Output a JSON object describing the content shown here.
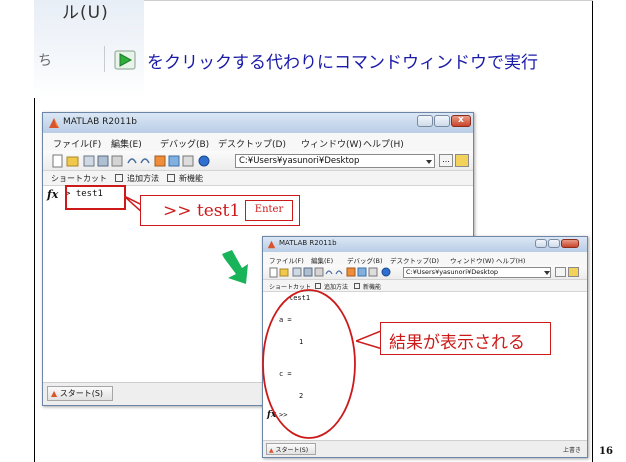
{
  "top_crop": {
    "menu_fragment": "ル(U)",
    "left_icon_fragment": "ち"
  },
  "headline": "をクリックする代わりにコマンドウィンドウで実行",
  "window_main": {
    "title": "MATLAB  R2011b",
    "menu": [
      "ファイル(F)",
      "編集(E)",
      "デバッグ(B)",
      "デスクトップ(D)",
      "ウィンドウ(W)",
      "ヘルプ(H)"
    ],
    "path": "C:¥Users¥yasunori¥Desktop",
    "shortcut_items": [
      "ショートカット",
      "追加方法",
      "新機能"
    ],
    "prompt": "> test1",
    "start_label": "スタート(S)"
  },
  "callout_command": {
    "text": ">> test1",
    "enter_label": "Enter"
  },
  "window_result": {
    "title": "MATLAB R2011b",
    "menu": [
      "ファイル(F)",
      "編集(E)",
      "デバッグ(B)",
      "デスクトップ(D)",
      "ウィンドウ(W)",
      "ヘルプ(H)"
    ],
    "path": "C:¥Users¥yasunori¥Desktop",
    "shortcut_items": [
      "ショートカット",
      "追加方法",
      "新機能"
    ],
    "output": {
      "cmd_echo": "test1",
      "a_label": "a =",
      "a_value": "1",
      "c_label": "c =",
      "c_value": "2",
      "prompt": ">>"
    },
    "start_label": "スタート(S)",
    "status_right": "上書き"
  },
  "callout_result": "結果が表示される",
  "page_number": "16",
  "colors": {
    "headline": "#1a1aa8",
    "callout_red": "#cc1a1a",
    "arrow_green": "#19b35a"
  }
}
